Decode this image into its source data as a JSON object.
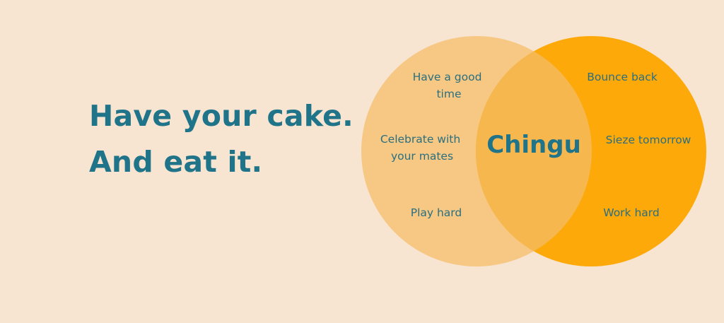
{
  "headline": {
    "line1": "Have your cake.",
    "line2": "And eat it."
  },
  "venn": {
    "left_color": "#f6c883",
    "right_color": "#fda90a",
    "overlap_color": "#f7b74f",
    "text_color": "#1f7489",
    "left_items": [
      {
        "lines": [
          "Have a good",
          "time"
        ]
      },
      {
        "lines": [
          "Celebrate with",
          "your mates"
        ]
      },
      {
        "lines": [
          "Play hard"
        ]
      }
    ],
    "center_label": "Chingu",
    "right_items": [
      {
        "lines": [
          "Bounce back"
        ]
      },
      {
        "lines": [
          "Sieze tomorrow"
        ]
      },
      {
        "lines": [
          "Work hard"
        ]
      }
    ]
  }
}
